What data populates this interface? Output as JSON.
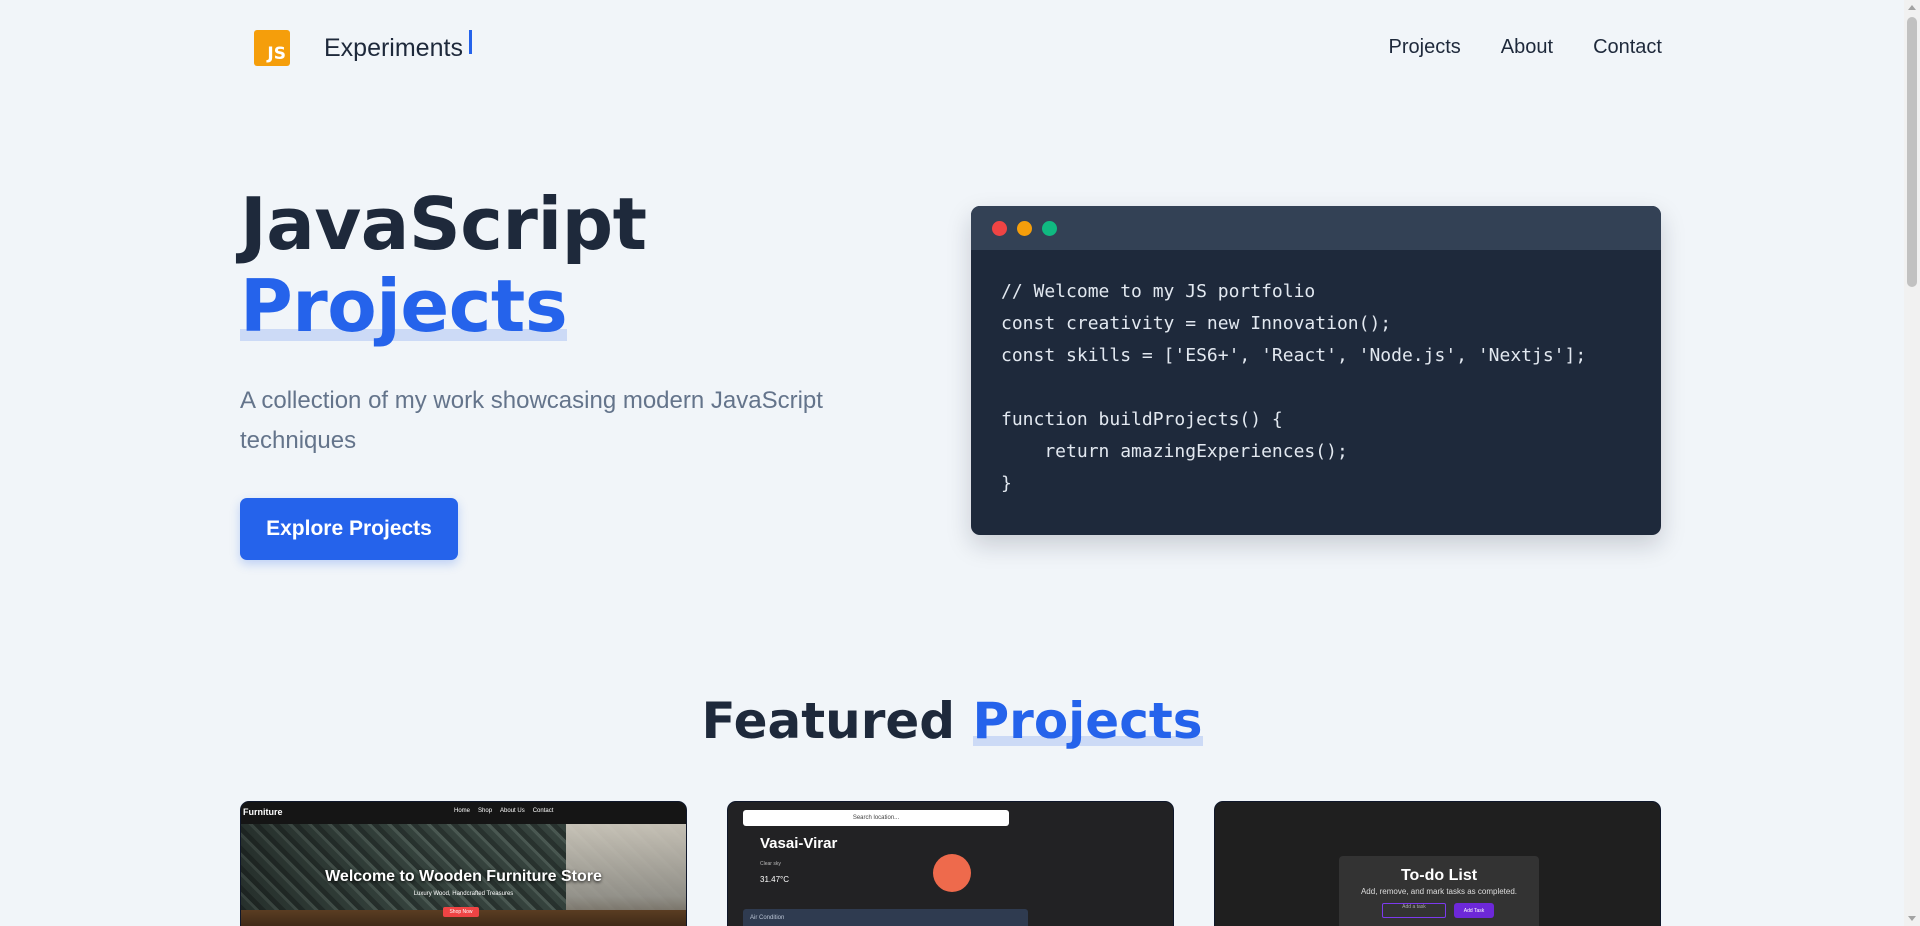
{
  "nav": {
    "logo_text": "JS",
    "brand": "Experiments",
    "links": [
      "Projects",
      "About",
      "Contact"
    ]
  },
  "hero": {
    "title_line1": "JavaScript",
    "title_line2": "Projects",
    "subtitle": "A collection of my work showcasing modern JavaScript techniques",
    "cta": "Explore Projects"
  },
  "code": {
    "lines": [
      "// Welcome to my JS portfolio",
      "const creativity = new Innovation();",
      "const skills = ['ES6+', 'React', 'Node.js', 'Nextjs'];",
      "",
      "function buildProjects() {",
      "    return amazingExperiences();",
      "}"
    ]
  },
  "featured": {
    "title_part1": "Featured",
    "title_part2": "Projects"
  },
  "cards": [
    {
      "brand": "Furniture",
      "nav": [
        "Home",
        "Shop",
        "About Us",
        "Contact"
      ],
      "headline": "Welcome to Wooden Furniture Store",
      "subline": "Luxury Wood, Handcrafted Treasures",
      "button": "Shop Now"
    },
    {
      "search_placeholder": "Search location...",
      "city": "Vasai-Virar",
      "meta": "Clear sky",
      "temp": "31.47°C",
      "section": "Air Condition"
    },
    {
      "title": "To-do List",
      "desc": "Add, remove, and mark tasks as completed.",
      "input_placeholder": "Add a task",
      "button": "Add Task"
    }
  ],
  "colors": {
    "accent": "#2563eb",
    "text": "#1e293b",
    "muted": "#64748b",
    "background": "#f1f5f9",
    "code_bg": "#1e293b",
    "code_bar": "#334155",
    "logo": "#f59e0b"
  }
}
